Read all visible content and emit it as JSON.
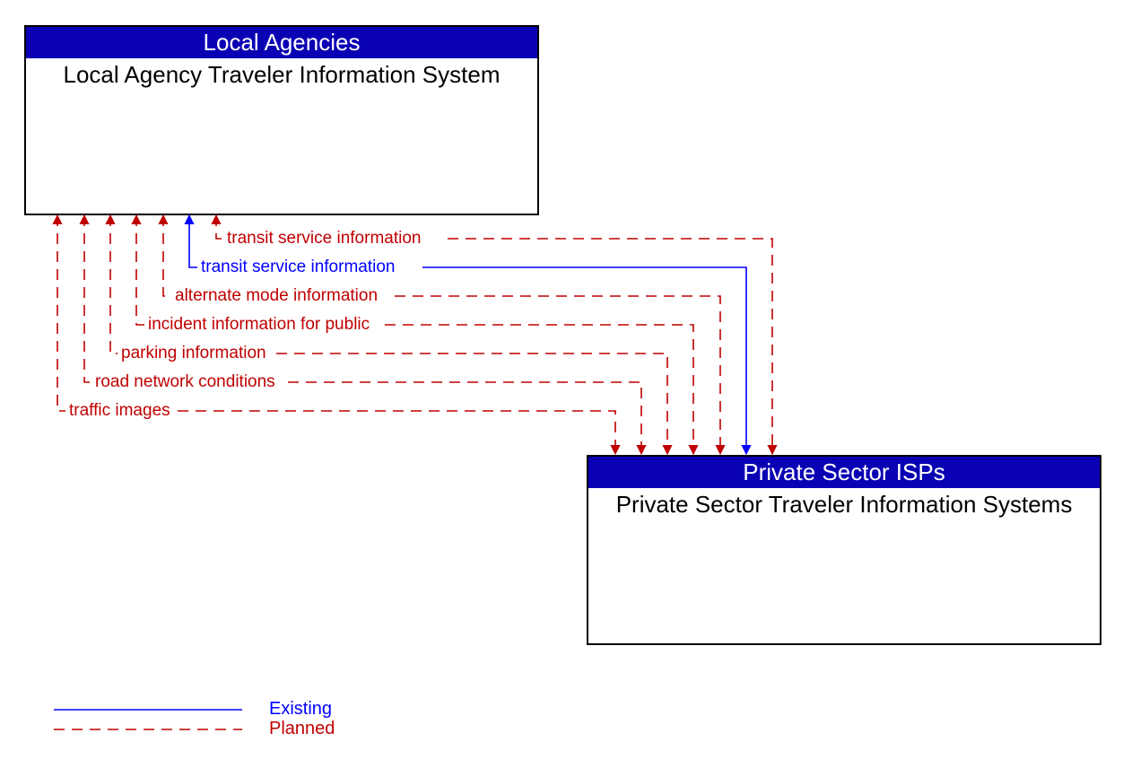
{
  "colors": {
    "accent": "#0A00B4",
    "existing": "#0000FF",
    "planned": "#C00000"
  },
  "nodes": {
    "top": {
      "header": "Local Agencies",
      "body": "Local Agency Traveler Information System"
    },
    "bottom": {
      "header": "Private Sector ISPs",
      "body": "Private Sector Traveler Information Systems"
    }
  },
  "flows": [
    {
      "label": "transit service information",
      "status": "planned"
    },
    {
      "label": "transit service information",
      "status": "existing"
    },
    {
      "label": "alternate mode information",
      "status": "planned"
    },
    {
      "label": "incident information for public",
      "status": "planned"
    },
    {
      "label": "parking information",
      "status": "planned"
    },
    {
      "label": "road network conditions",
      "status": "planned"
    },
    {
      "label": "traffic images",
      "status": "planned"
    }
  ],
  "legend": {
    "existing": "Existing",
    "planned": "Planned"
  }
}
